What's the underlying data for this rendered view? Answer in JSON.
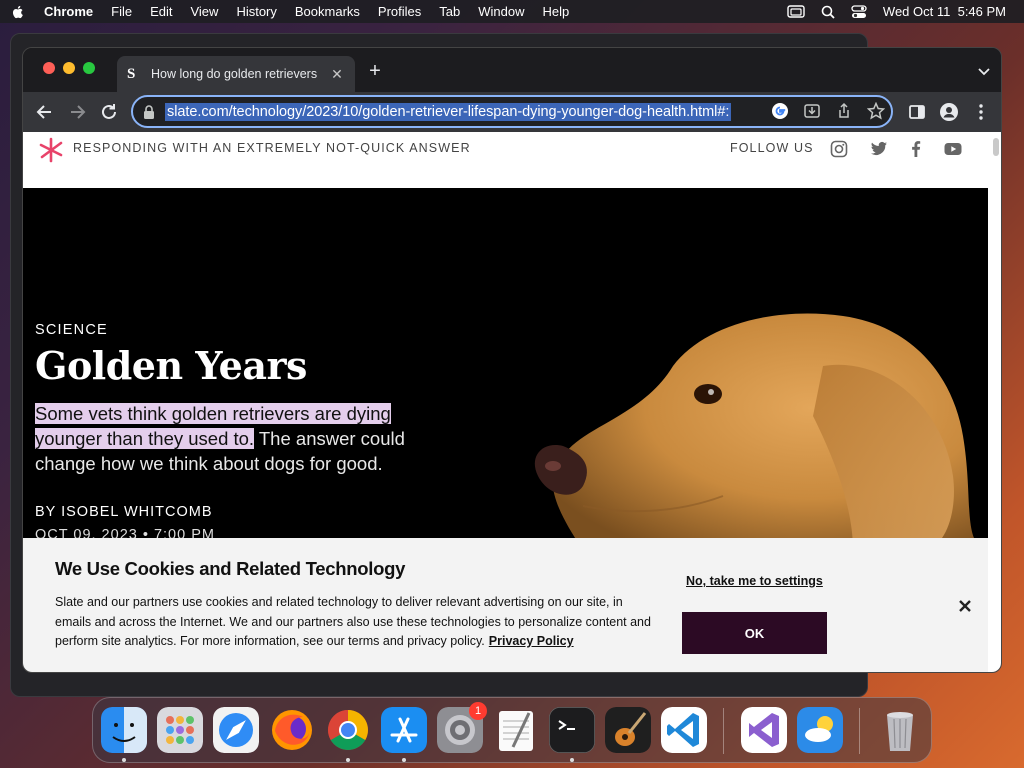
{
  "menubar": {
    "app_name": "Chrome",
    "items": [
      "File",
      "Edit",
      "View",
      "History",
      "Bookmarks",
      "Profiles",
      "Tab",
      "Window",
      "Help"
    ],
    "clock": "Wed Oct 11  5:46 PM"
  },
  "browser": {
    "tab_title": "How long do golden retrievers",
    "tab_favicon": "S",
    "url": "slate.com/technology/2023/10/golden-retriever-lifespan-dying-younger-dog-health.html#:",
    "accent": "#8ab4f8"
  },
  "site": {
    "slogan": "RESPONDING WITH AN EXTREMELY NOT-QUICK ANSWER",
    "follow_label": "FOLLOW US",
    "social_icons": [
      "instagram-icon",
      "twitter-icon",
      "facebook-icon",
      "youtube-icon"
    ]
  },
  "article": {
    "kicker": "SCIENCE",
    "headline": "Golden Years",
    "dek_highlighted": "Some vets think golden retrievers are dying younger than they used to.",
    "dek_rest": " The answer could change how we think about dogs for good.",
    "byline": "BY ISOBEL WHITCOMB",
    "date": "OCT 09, 2023 • 7:00 PM"
  },
  "cookie_banner": {
    "title": "We Use Cookies and Related Technology",
    "body": "Slate and our partners use cookies and related technology to deliver relevant advertising on our site, in emails and across the Internet. We and our partners also use these technologies to personalize content and perform site analytics. For more information, see our terms and privacy policy.",
    "privacy_link": "Privacy Policy",
    "settings_link": "No, take me to settings",
    "ok_label": "OK",
    "ok_color": "#2c0a24"
  },
  "dock": {
    "apps": [
      "Finder",
      "Launchpad",
      "Safari",
      "Firefox",
      "Chrome",
      "App Store",
      "System Settings",
      "TextEdit",
      "Terminal",
      "GarageBand",
      "Visual Studio Code",
      "Visual Studio",
      "Weather",
      "Trash"
    ],
    "settings_badge": "1"
  }
}
